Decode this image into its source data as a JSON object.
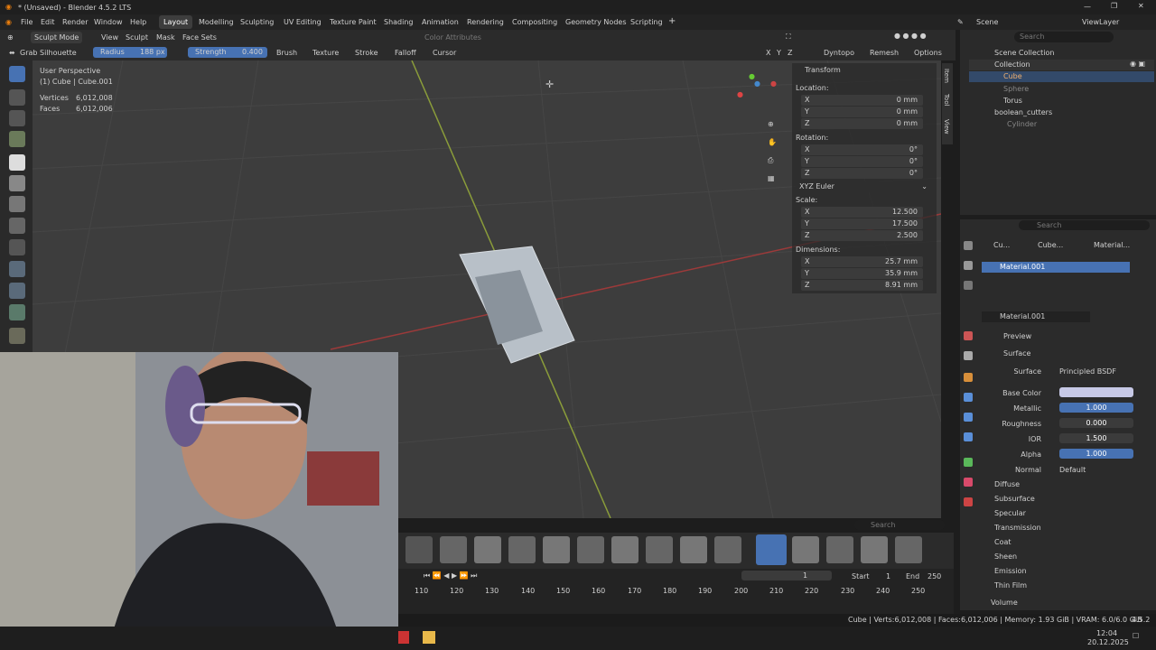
{
  "window": {
    "title": "* (Unsaved) - Blender 4.5.2 LTS"
  },
  "menus": {
    "file": "File",
    "edit": "Edit",
    "render": "Render",
    "window": "Window",
    "help": "Help"
  },
  "workspaces": [
    "Layout",
    "Modelling",
    "Sculpting",
    "UV Editing",
    "Texture Paint",
    "Shading",
    "Animation",
    "Rendering",
    "Compositing",
    "Geometry Nodes",
    "Scripting"
  ],
  "scene": {
    "label": "Scene",
    "viewlayer": "ViewLayer"
  },
  "header": {
    "mode": "Sculpt Mode",
    "view": "View",
    "sculpt": "Sculpt",
    "mask": "Mask",
    "face_sets": "Face Sets",
    "color_attributes": "Color Attributes",
    "axes": [
      "X",
      "Y",
      "Z"
    ],
    "dyntopo": "Dyntopo",
    "remesh": "Remesh",
    "options": "Options"
  },
  "toolsettings": {
    "tool": "Grab Silhouette",
    "radius_label": "Radius",
    "radius_value": "188 px",
    "strength_label": "Strength",
    "strength_value": "0.400",
    "brush": "Brush",
    "texture": "Texture",
    "stroke": "Stroke",
    "falloff": "Falloff",
    "cursor": "Cursor"
  },
  "viewport": {
    "perspective": "User Perspective",
    "object": "(1) Cube | Cube.001",
    "vertices_label": "Vertices",
    "vertices": "6,012,008",
    "faces_label": "Faces",
    "faces": "6,012,006"
  },
  "transform": {
    "title": "Transform",
    "location": "Location:",
    "rotation": "Rotation:",
    "scale": "Scale:",
    "dimensions": "Dimensions:",
    "loc": [
      {
        "axis": "X",
        "v": "0 mm"
      },
      {
        "axis": "Y",
        "v": "0 mm"
      },
      {
        "axis": "Z",
        "v": "0 mm"
      }
    ],
    "rot": [
      {
        "axis": "X",
        "v": "0°"
      },
      {
        "axis": "Y",
        "v": "0°"
      },
      {
        "axis": "Z",
        "v": "0°"
      }
    ],
    "rot_mode": "XYZ Euler",
    "scl": [
      {
        "axis": "X",
        "v": "12.500"
      },
      {
        "axis": "Y",
        "v": "17.500"
      },
      {
        "axis": "Z",
        "v": "2.500"
      }
    ],
    "dim": [
      {
        "axis": "X",
        "v": "25.7 mm"
      },
      {
        "axis": "Y",
        "v": "35.9 mm"
      },
      {
        "axis": "Z",
        "v": "8.91 mm"
      }
    ]
  },
  "side_tabs": [
    "Item",
    "Tool",
    "View"
  ],
  "outliner": {
    "search": "Search",
    "scene_collection": "Scene Collection",
    "collection": "Collection",
    "items": [
      "Cube",
      "Sphere",
      "Torus"
    ],
    "boolean": "boolean_cutters",
    "cylinder": "Cylinder"
  },
  "properties": {
    "search": "Search",
    "crumbs": [
      "Cu...",
      "Cube...",
      "Material..."
    ],
    "slot": "Material.001",
    "material": "Material.001",
    "preview": "Preview",
    "surface": "Surface",
    "surface_label": "Surface",
    "surface_value": "Principled BSDF",
    "base_color": "Base Color",
    "base_color_hex": "#c7c9e6",
    "metallic": "Metallic",
    "metallic_v": "1.000",
    "roughness": "Roughness",
    "roughness_v": "0.000",
    "ior": "IOR",
    "ior_v": "1.500",
    "alpha": "Alpha",
    "alpha_v": "1.000",
    "normal": "Normal",
    "normal_v": "Default",
    "sections": [
      "Diffuse",
      "Subsurface",
      "Specular",
      "Transmission",
      "Coat",
      "Sheen",
      "Emission",
      "Thin Film"
    ],
    "volume": "Volume"
  },
  "brush_search": "Search",
  "timeline": {
    "current": "1",
    "start_label": "Start",
    "start": "1",
    "end_label": "End",
    "end": "250",
    "ticks": [
      "110",
      "120",
      "130",
      "140",
      "150",
      "160",
      "170",
      "180",
      "190",
      "200",
      "210",
      "220",
      "230",
      "240",
      "250"
    ]
  },
  "status": "Cube | Verts:6,012,008 | Faces:6,012,006 | Memory: 1.93 GiB | VRAM: 6.0/6.0 GiB",
  "version": "4.5.2",
  "clock": {
    "time": "12:04",
    "date": "20.12.2025"
  }
}
